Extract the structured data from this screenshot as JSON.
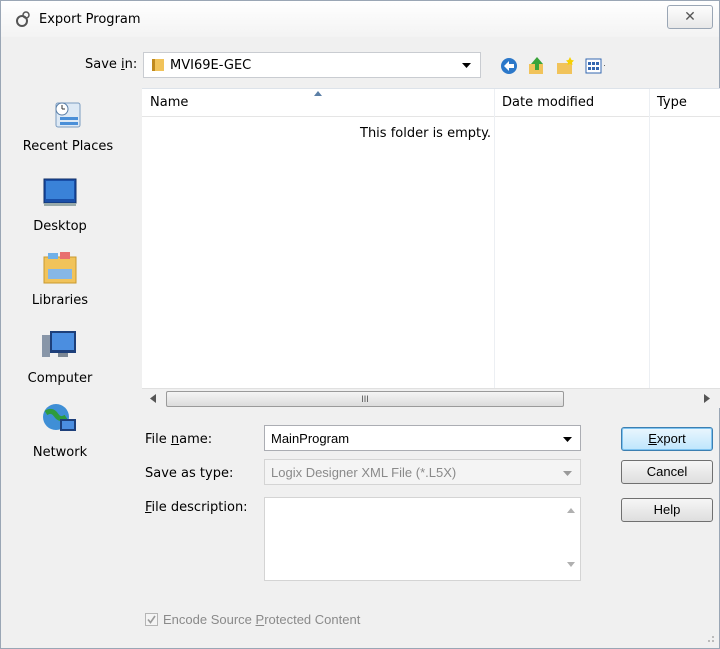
{
  "window": {
    "title": "Export Program",
    "close_glyph": "✕"
  },
  "save_in": {
    "label_pre": "Save ",
    "label_u": "i",
    "label_post": "n:",
    "value": "MVI69E-GEC"
  },
  "toolbar": {
    "icons": [
      "back-icon",
      "up-folder-icon",
      "new-folder-icon",
      "view-menu-icon"
    ]
  },
  "sidebar": {
    "items": [
      {
        "label": "Recent Places",
        "icon": "recent-places-icon"
      },
      {
        "label": "Desktop",
        "icon": "desktop-icon"
      },
      {
        "label": "Libraries",
        "icon": "libraries-icon"
      },
      {
        "label": "Computer",
        "icon": "computer-icon"
      },
      {
        "label": "Network",
        "icon": "network-icon"
      }
    ]
  },
  "filelist": {
    "columns": [
      "Name",
      "Date modified",
      "Type"
    ],
    "empty_text": "This folder is empty.",
    "scroll_thumb_glyph": "III"
  },
  "form": {
    "file_name": {
      "label_pre": "File ",
      "label_u": "n",
      "label_post": "ame:",
      "value": "MainProgram"
    },
    "save_as_type": {
      "label": "Save as type:",
      "value": "Logix Designer XML File (*.L5X)"
    },
    "file_description": {
      "label_u": "F",
      "label_post": "ile description:",
      "value": ""
    },
    "encode_checkbox": {
      "label_pre": "Encode Source ",
      "label_u": "P",
      "label_post": "rotected Content",
      "checked": true,
      "enabled": false
    }
  },
  "buttons": {
    "export": {
      "label_u": "E",
      "label_post": "xport"
    },
    "cancel": {
      "label": "Cancel"
    },
    "help": {
      "label": "Help"
    }
  }
}
